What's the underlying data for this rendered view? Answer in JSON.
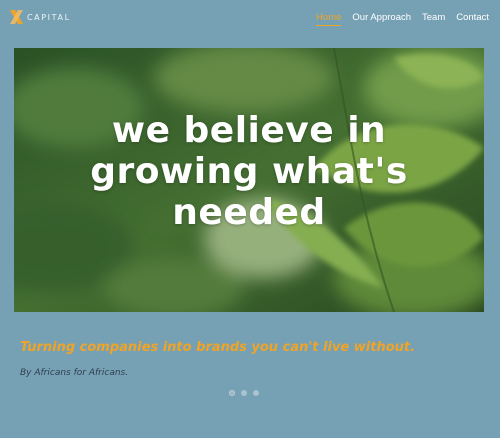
{
  "brand": {
    "name": "CAPITAL",
    "mark_icon": "x-logo-icon",
    "accent": "#f0a427"
  },
  "nav": {
    "items": [
      {
        "label": "Home",
        "active": true
      },
      {
        "label": "Our Approach",
        "active": false
      },
      {
        "label": "Team",
        "active": false
      },
      {
        "label": "Contact",
        "active": false
      }
    ]
  },
  "hero": {
    "lines": [
      "we believe in",
      "growing what's",
      "needed"
    ]
  },
  "tagline": "Turning companies into brands you can't live without.",
  "subline": "By Africans for Africans.",
  "carousel": {
    "slides": 3,
    "active_index": 0
  },
  "colors": {
    "background": "#76a1b4",
    "text": "#ffffff"
  }
}
